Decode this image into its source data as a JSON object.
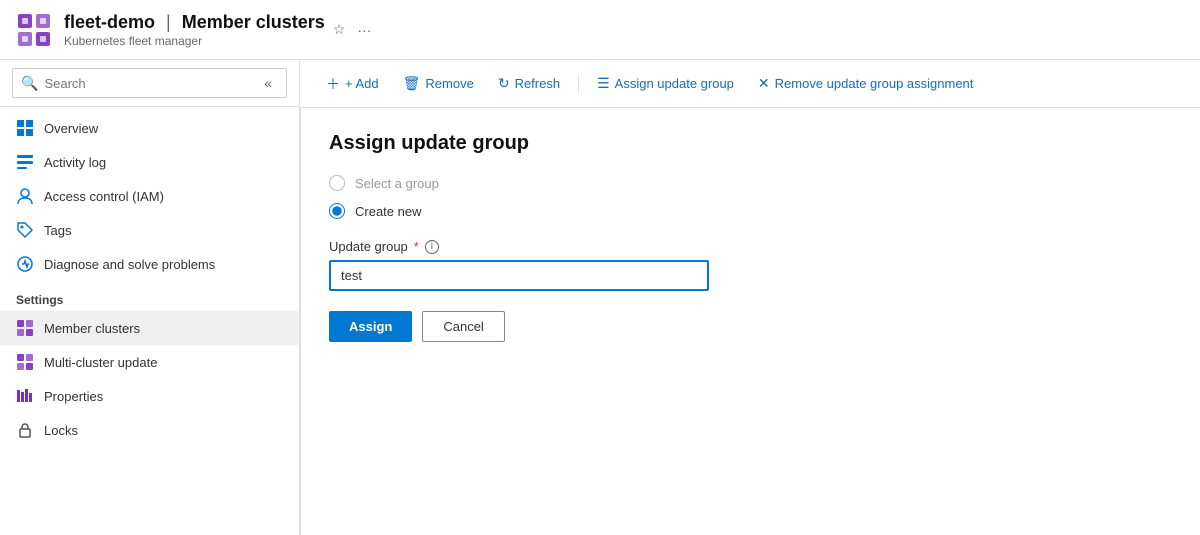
{
  "header": {
    "app_name": "fleet-demo",
    "separator": "|",
    "page_name": "Member clusters",
    "subtitle": "Kubernetes fleet manager",
    "star_icon": "☆",
    "more_icon": "···"
  },
  "search": {
    "placeholder": "Search"
  },
  "collapse_label": "«",
  "sidebar": {
    "items": [
      {
        "id": "overview",
        "label": "Overview",
        "icon": "grid"
      },
      {
        "id": "activity-log",
        "label": "Activity log",
        "icon": "list"
      },
      {
        "id": "access-control",
        "label": "Access control (IAM)",
        "icon": "person"
      },
      {
        "id": "tags",
        "label": "Tags",
        "icon": "tag"
      },
      {
        "id": "diagnose",
        "label": "Diagnose and solve problems",
        "icon": "wrench"
      }
    ],
    "settings_section": "Settings",
    "settings_items": [
      {
        "id": "member-clusters",
        "label": "Member clusters",
        "icon": "grid-purple",
        "active": true
      },
      {
        "id": "multi-cluster-update",
        "label": "Multi-cluster update",
        "icon": "grid-purple"
      },
      {
        "id": "properties",
        "label": "Properties",
        "icon": "bars-purple"
      },
      {
        "id": "locks",
        "label": "Locks",
        "icon": "lock"
      }
    ]
  },
  "toolbar": {
    "add_label": "+ Add",
    "remove_label": "Remove",
    "refresh_label": "Refresh",
    "assign_update_group_label": "Assign update group",
    "remove_assignment_label": "Remove update group assignment"
  },
  "panel": {
    "title": "Assign update group",
    "select_group_option": "Select a group",
    "create_new_option": "Create new",
    "selected_option": "create_new",
    "update_group_label": "Update group",
    "update_group_required": true,
    "update_group_info": "i",
    "update_group_value": "test",
    "assign_button": "Assign",
    "cancel_button": "Cancel"
  }
}
